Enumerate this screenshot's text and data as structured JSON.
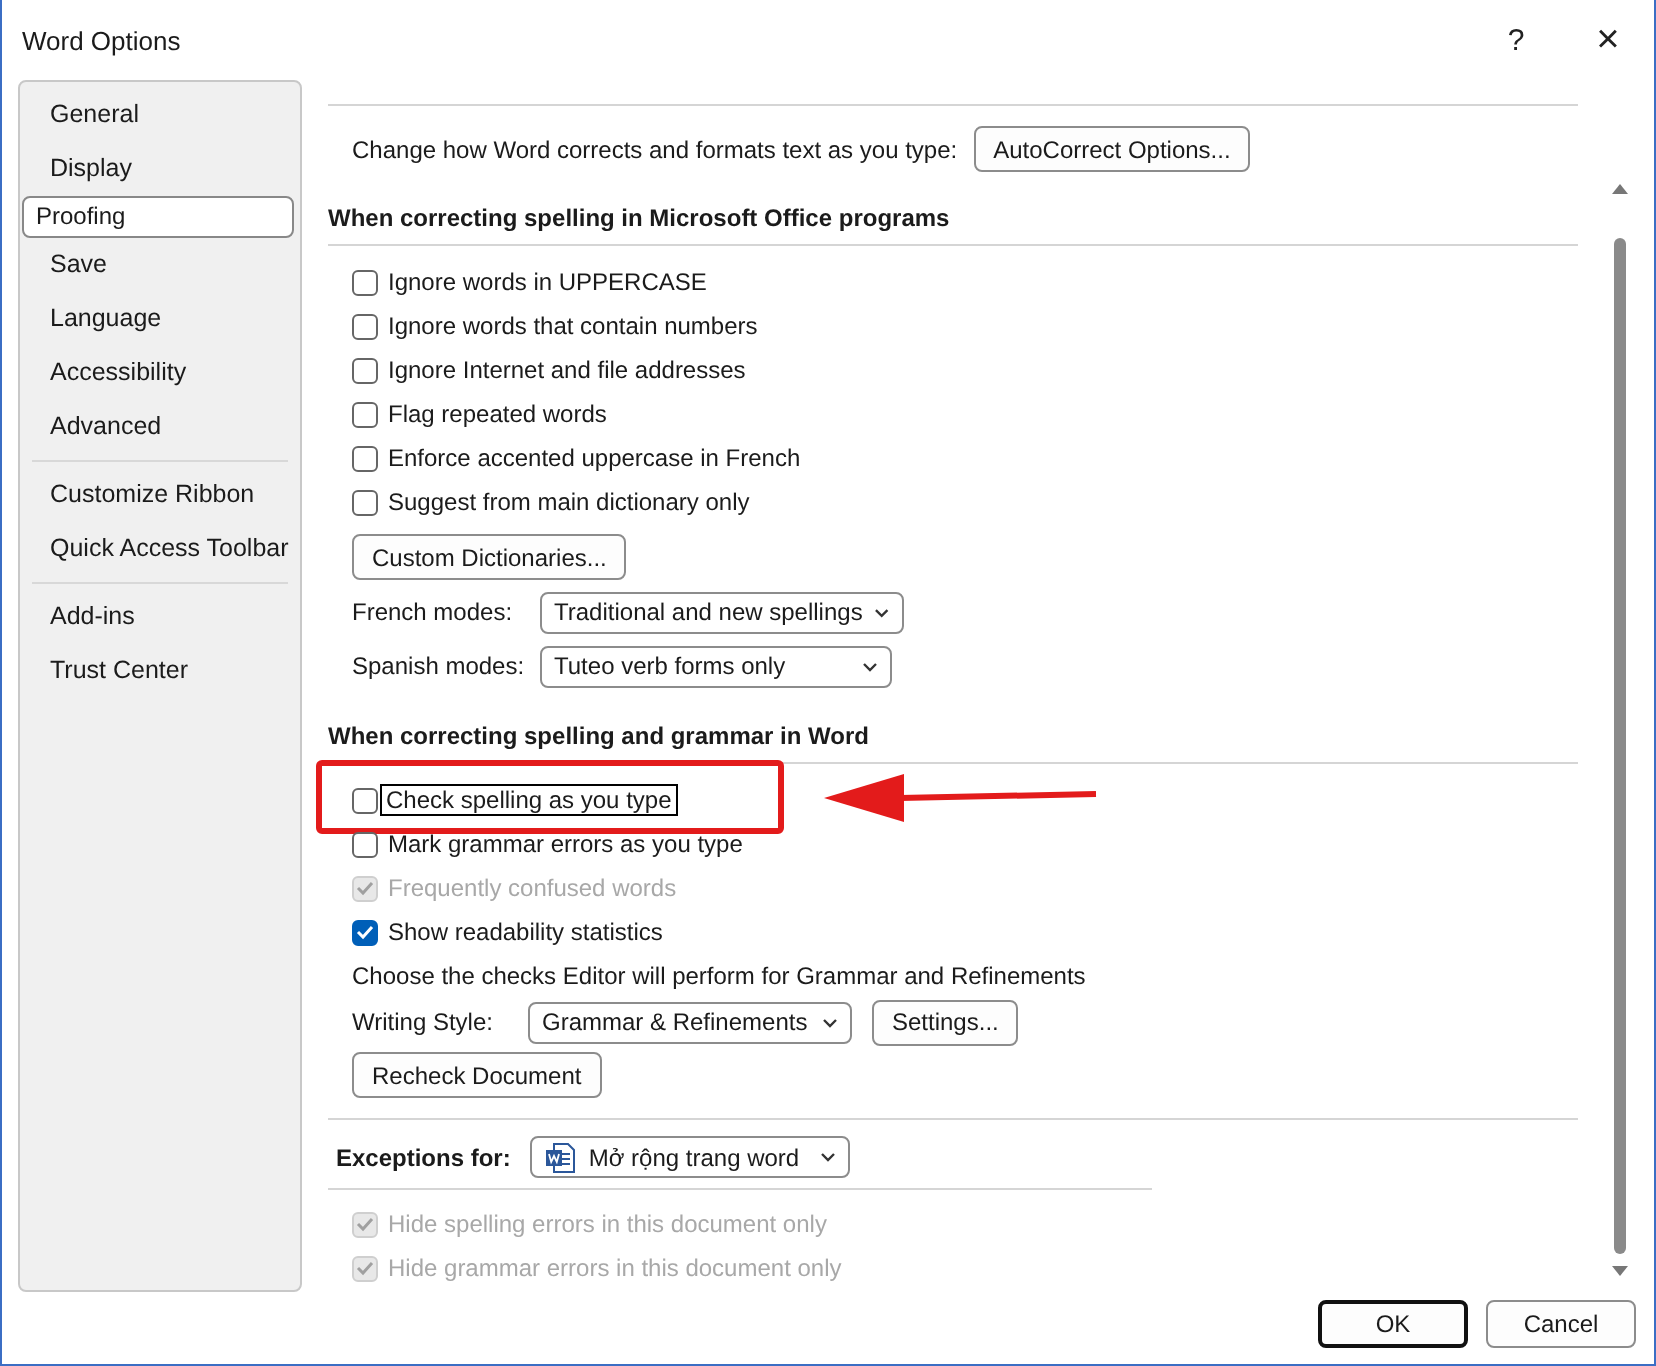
{
  "window": {
    "title": "Word Options",
    "help": "?",
    "close": "×"
  },
  "sidebar": {
    "groups": [
      {
        "items": [
          {
            "label": "General",
            "selected": false
          },
          {
            "label": "Display",
            "selected": false
          },
          {
            "label": "Proofing",
            "selected": true
          },
          {
            "label": "Save",
            "selected": false
          },
          {
            "label": "Language",
            "selected": false
          },
          {
            "label": "Accessibility",
            "selected": false
          },
          {
            "label": "Advanced",
            "selected": false
          }
        ]
      },
      {
        "items": [
          {
            "label": "Customize Ribbon",
            "selected": false
          },
          {
            "label": "Quick Access Toolbar",
            "selected": false
          }
        ]
      },
      {
        "items": [
          {
            "label": "Add-ins",
            "selected": false
          },
          {
            "label": "Trust Center",
            "selected": false
          }
        ]
      }
    ]
  },
  "autocorrect": {
    "label": "Change how Word corrects and formats text as you type:",
    "button": "AutoCorrect Options..."
  },
  "spelling_section": {
    "heading": "When correcting spelling in Microsoft Office programs",
    "options": [
      {
        "label": "Ignore words in UPPERCASE",
        "checked": false,
        "disabled": false
      },
      {
        "label": "Ignore words that contain numbers",
        "checked": false,
        "disabled": false
      },
      {
        "label": "Ignore Internet and file addresses",
        "checked": false,
        "disabled": false
      },
      {
        "label": "Flag repeated words",
        "checked": false,
        "disabled": false
      },
      {
        "label": "Enforce accented uppercase in French",
        "checked": false,
        "disabled": false
      },
      {
        "label": "Suggest from main dictionary only",
        "checked": false,
        "disabled": false
      }
    ],
    "dictionaries_button": "Custom Dictionaries...",
    "modes": [
      {
        "label": "French modes:",
        "value": "Traditional and new spellings"
      },
      {
        "label": "Spanish modes:",
        "value": "Tuteo verb forms only"
      }
    ]
  },
  "grammar_section": {
    "heading": "When correcting spelling and grammar in Word",
    "options": [
      {
        "label": "Check spelling as you type",
        "checked": false,
        "disabled": false,
        "highlighted": true
      },
      {
        "label": "Mark grammar errors as you type",
        "checked": false,
        "disabled": false,
        "highlighted": false
      },
      {
        "label": "Frequently confused words",
        "checked": true,
        "disabled": true,
        "highlighted": false
      },
      {
        "label": "Show readability statistics",
        "checked": true,
        "disabled": false,
        "highlighted": false
      }
    ],
    "instruction": "Choose the checks Editor will perform for Grammar and Refinements",
    "writing_style": {
      "label": "Writing Style:",
      "value": "Grammar & Refinements"
    },
    "settings_button": "Settings...",
    "recheck_button": "Recheck Document"
  },
  "exceptions": {
    "label": "Exceptions for:",
    "document": "Mở rộng trang word",
    "options": [
      {
        "label": "Hide spelling errors in this document only",
        "checked": true,
        "disabled": true
      },
      {
        "label": "Hide grammar errors in this document only",
        "checked": true,
        "disabled": true
      }
    ]
  },
  "buttons": [
    {
      "label": "OK",
      "default": true
    },
    {
      "label": "Cancel",
      "default": false
    }
  ]
}
